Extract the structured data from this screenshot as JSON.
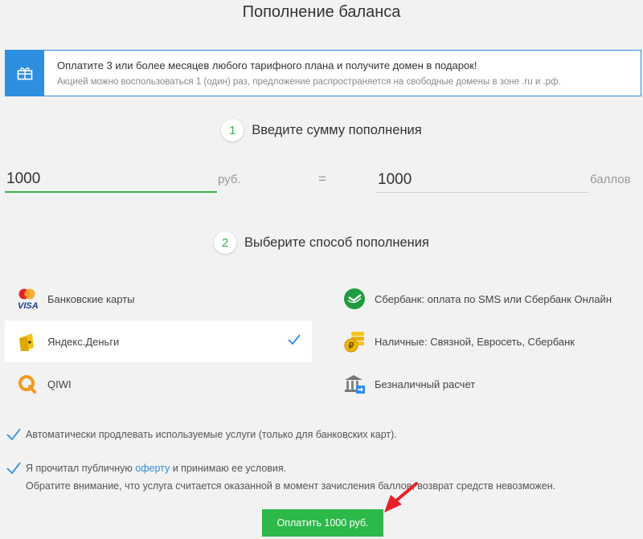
{
  "page": {
    "title": "Пополнение баланса"
  },
  "promo": {
    "icon": "gift-icon",
    "main_text": "Оплатите 3 или более месяцев любого тарифного плана и получите домен в подарок!",
    "sub_text": "Акцией можно воспользоваться 1 (один) раз, предложение распространяется на свободные домены в зоне .ru и .рф."
  },
  "step1": {
    "number": "1",
    "label": "Введите сумму пополнения"
  },
  "amount": {
    "value": "1000",
    "unit": "руб."
  },
  "equals": "=",
  "points": {
    "value": "1000",
    "unit": "баллов"
  },
  "step2": {
    "number": "2",
    "label": "Выберите способ пополнения"
  },
  "methods": [
    {
      "label": "Банковские карты",
      "icon": "mastercard-visa-icon",
      "selected": false
    },
    {
      "label": "Яндекс.Деньги",
      "icon": "yandex-money-icon",
      "selected": true
    },
    {
      "label": "QIWI",
      "icon": "qiwi-icon",
      "selected": false
    },
    {
      "label": "Сбербанк: оплата по SMS или Сбербанк Онлайн",
      "icon": "sberbank-icon",
      "selected": false
    },
    {
      "label": "Наличные: Связной, Евросеть, Сбербанк",
      "icon": "cash-coins-icon",
      "selected": false
    },
    {
      "label": "Безналичный расчет",
      "icon": "bank-transfer-icon",
      "selected": false
    }
  ],
  "options": {
    "auto_renew": {
      "label": "Автоматически продлевать используемые услуги (только для банковских карт).",
      "checked": true
    },
    "agree": {
      "prefix": "Я прочитал публичную ",
      "link": "оферту",
      "suffix": " и принимаю ее условия.",
      "checked": true
    }
  },
  "notice": "Обратите внимание, что услуга считается оказанной в момент зачисления баллов, возврат средств невозможен.",
  "pay_button": {
    "label": "Оплатить 1000 руб."
  },
  "colors": {
    "accent_green": "#2db84a",
    "accent_blue": "#2e8fe0",
    "arrow_red": "#e8202a"
  }
}
